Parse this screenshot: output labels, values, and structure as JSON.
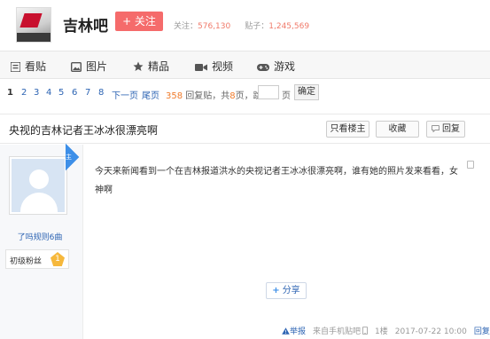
{
  "header": {
    "forum_name": "吉林吧",
    "follow_label": "+ 关注",
    "followers_label": "关注：",
    "followers_count": "576,130",
    "posts_label": "贴子：",
    "posts_count": "1,245,569"
  },
  "nav": {
    "items": [
      {
        "label": "看贴",
        "icon": "list-icon"
      },
      {
        "label": "图片",
        "icon": "image-icon"
      },
      {
        "label": "精品",
        "icon": "star-icon"
      },
      {
        "label": "视频",
        "icon": "video-icon"
      },
      {
        "label": "游戏",
        "icon": "gamepad-icon"
      }
    ]
  },
  "pager": {
    "pages": [
      "1",
      "2",
      "3",
      "4",
      "5",
      "6",
      "7",
      "8"
    ],
    "current": "1",
    "next_label": "下一页",
    "last_label": "尾页",
    "reply_count": "358",
    "reply_suffix": " 回复贴，共",
    "total_pages": "8",
    "pages_suffix": "页，跳到",
    "jump_unit": "页",
    "jump_button": "确定"
  },
  "thread": {
    "title": "央视的吉林记者王冰冰很漂亮啊",
    "only_op_label": "只看楼主",
    "collect_label": "收藏",
    "reply_label": "回复"
  },
  "post": {
    "badge": "楼主",
    "author_name": "了吗规则6曲",
    "level_name": "初级粉丝",
    "level_num": "1",
    "content": "今天来新闻看到一个在吉林报道洪水的央视记者王冰冰很漂亮啊，谁有她的照片发来看看，女神啊",
    "share_label": "分享",
    "report_label": "举报",
    "source_label": "来自手机贴吧",
    "floor": "1楼",
    "timestamp": "2017-07-22 10:00",
    "reply_label": "回复"
  },
  "colors": {
    "accent_blue": "#2d64b3",
    "follow_red": "#f56b6b",
    "badge_blue": "#3d8fe8"
  }
}
